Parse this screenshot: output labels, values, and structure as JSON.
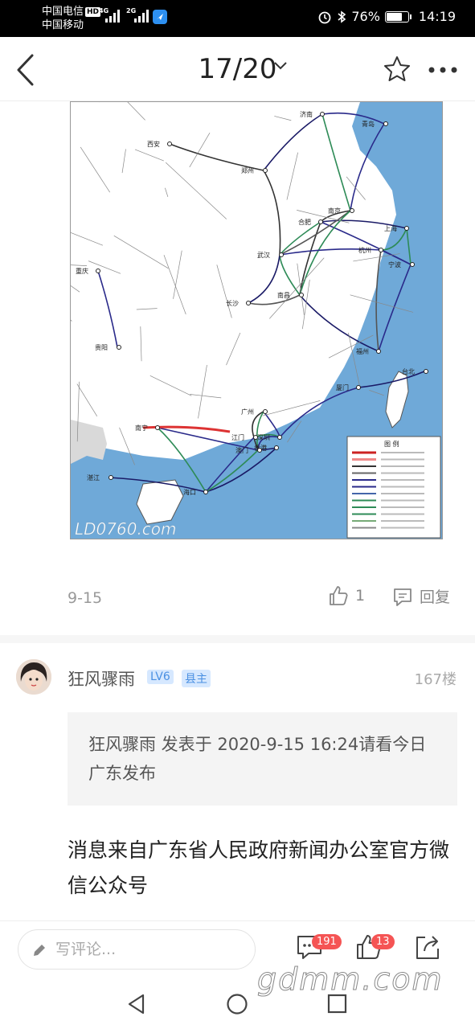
{
  "status_bar": {
    "carrier1": "中国电信",
    "hd": "HD",
    "carrier2": "中国移动",
    "net1": "4G",
    "net2": "2G",
    "battery": "76%",
    "battery_level": 0.76,
    "time": "14:19"
  },
  "nav": {
    "title": "17/20"
  },
  "map": {
    "cities": [
      "济南",
      "青岛",
      "西安",
      "郑州",
      "合肥",
      "南京",
      "上海",
      "武汉",
      "杭州",
      "宁波",
      "重庆",
      "南昌",
      "长沙",
      "贵阳",
      "福州",
      "台北",
      "厦门",
      "广州",
      "南宁",
      "湛江",
      "深圳",
      "江门",
      "香港",
      "澳门",
      "海口"
    ],
    "legend_title": "图 例",
    "watermark": "LD0760.com"
  },
  "post": {
    "date": "9-15",
    "likes": "1",
    "reply_label": "回复"
  },
  "reply": {
    "user": "狂风骤雨",
    "level": "LV6",
    "role": "县主",
    "floor": "167楼",
    "quote": "狂风骤雨 发表于 2020-9-15 16:24请看今日广东发布",
    "body": "消息来自广东省人民政府新闻办公室官方微信公众号"
  },
  "bottom_bar": {
    "comment_placeholder": "写评论...",
    "comment_count": "191",
    "like_count": "13"
  },
  "watermark": "gdmm.com",
  "colors": {
    "accent": "#4a90e2",
    "badge_red": "#f55454",
    "sea": "#6fa9d8"
  }
}
